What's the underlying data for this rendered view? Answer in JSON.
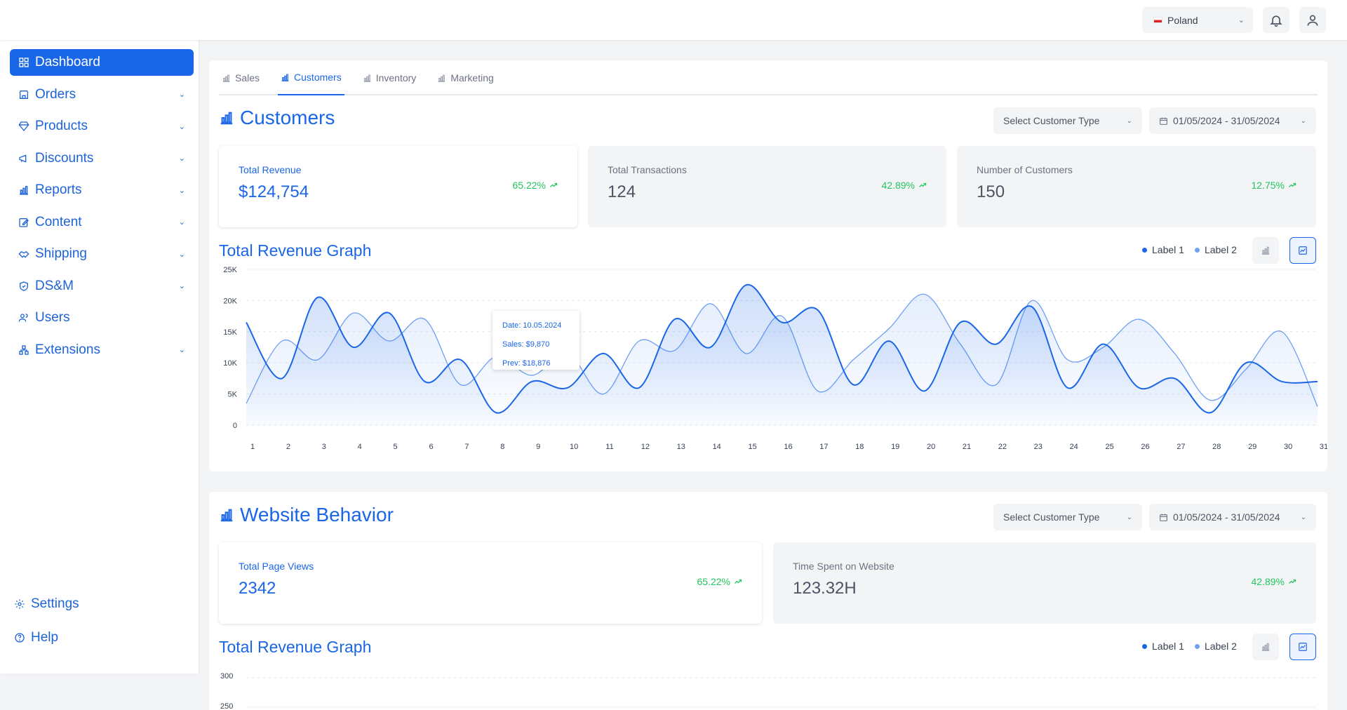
{
  "topbar": {
    "country": "Poland",
    "icons": [
      "bell-icon",
      "user-icon"
    ]
  },
  "sidebar": {
    "items": [
      {
        "label": "Dashboard",
        "icon": "dashboard-icon",
        "active": true
      },
      {
        "label": "Orders",
        "icon": "store-icon"
      },
      {
        "label": "Products",
        "icon": "diamond-icon"
      },
      {
        "label": "Discounts",
        "icon": "megaphone-icon"
      },
      {
        "label": "Reports",
        "icon": "bar-chart-icon"
      },
      {
        "label": "Content",
        "icon": "edit-icon"
      },
      {
        "label": "Shipping",
        "icon": "handshake-icon"
      },
      {
        "label": "DS&M",
        "icon": "shield-icon"
      },
      {
        "label": "Users",
        "icon": "users-icon"
      },
      {
        "label": "Extensions",
        "icon": "extensions-icon"
      }
    ],
    "settings": "Settings",
    "help": "Help"
  },
  "tabs": [
    "Sales",
    "Customers",
    "Inventory",
    "Marketing"
  ],
  "active_tab": "Customers",
  "customers": {
    "title": "Customers",
    "customer_type_placeholder": "Select Customer Type",
    "date_range": "01/05/2024 - 31/05/2024",
    "stats": [
      {
        "label": "Total Revenue",
        "value": "$124,754",
        "change": "65.22%"
      },
      {
        "label": "Total Transactions",
        "value": "124",
        "change": "42.89%"
      },
      {
        "label": "Number of Customers",
        "value": "150",
        "change": "12.75%"
      }
    ],
    "graph_title": "Total Revenue Graph",
    "legend": [
      "Label 1",
      "Label 2"
    ],
    "tooltip": {
      "date": "Date: 10.05.2024",
      "sales": "Sales: $9,870",
      "prev": "Prev: $18,876"
    }
  },
  "website": {
    "title": "Website Behavior",
    "customer_type_placeholder": "Select Customer Type",
    "date_range": "01/05/2024 - 31/05/2024",
    "stats": [
      {
        "label": "Total Page Views",
        "value": "2342",
        "change": "65.22%"
      },
      {
        "label": "Time Spent on Website",
        "value": "123.32H",
        "change": "42.89%"
      }
    ],
    "graph_title": "Total Revenue Graph",
    "legend": [
      "Label 1",
      "Label 2"
    ],
    "y_ticks": [
      "300",
      "250"
    ]
  },
  "colors": {
    "accent": "#1a66e8",
    "positive": "#22c55e",
    "series1": "#1a66e8",
    "series2": "#6fa0f2"
  },
  "chart_data": {
    "type": "area",
    "title": "Total Revenue Graph",
    "x": [
      1,
      2,
      3,
      4,
      5,
      6,
      7,
      8,
      9,
      10,
      11,
      12,
      13,
      14,
      15,
      16,
      17,
      18,
      19,
      20,
      21,
      22,
      23,
      24,
      25,
      26,
      27,
      28,
      29,
      30,
      31
    ],
    "x_tick_labels": [
      "1",
      "2",
      "3",
      "4",
      "5",
      "6",
      "7",
      "8",
      "9",
      "10",
      "11",
      "12",
      "13",
      "14",
      "15",
      "16",
      "17",
      "18",
      "19",
      "20",
      "21",
      "22",
      "23",
      "24",
      "25",
      "26",
      "27",
      "28",
      "29",
      "30",
      "31"
    ],
    "y_ticks": [
      0,
      5000,
      10000,
      15000,
      20000,
      25000
    ],
    "y_tick_labels": [
      "0",
      "5K",
      "10K",
      "15K",
      "20K",
      "25K"
    ],
    "ylim": [
      0,
      25000
    ],
    "grid": true,
    "legend_position": "top-right",
    "series": [
      {
        "name": "Label 1",
        "values": [
          16500,
          7500,
          20500,
          12500,
          18000,
          7000,
          10500,
          2000,
          7000,
          6000,
          11500,
          6000,
          17000,
          12500,
          22500,
          16500,
          18500,
          6500,
          13500,
          5500,
          16500,
          13000,
          19000,
          6000,
          13000,
          6000,
          7500,
          2000,
          10000,
          7000,
          7000
        ]
      },
      {
        "name": "Label 2",
        "values": [
          3500,
          13500,
          10500,
          18000,
          13500,
          17000,
          6500,
          11000,
          8000,
          11500,
          5000,
          13500,
          12000,
          19500,
          11500,
          17500,
          5500,
          10500,
          15500,
          21000,
          13000,
          6500,
          20000,
          10500,
          12500,
          17000,
          11500,
          4000,
          9000,
          15000,
          3000
        ]
      }
    ]
  }
}
